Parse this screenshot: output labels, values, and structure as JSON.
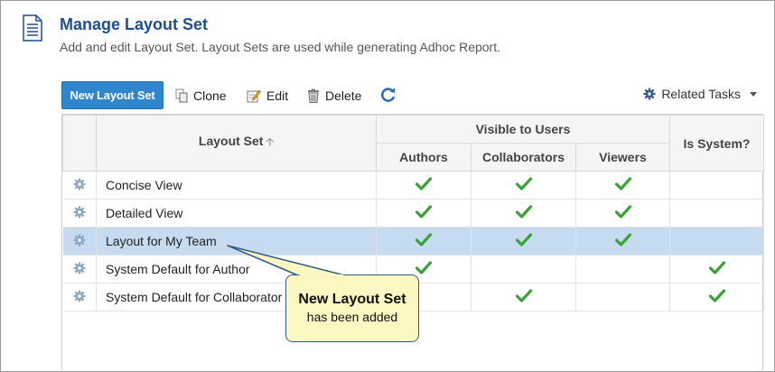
{
  "header": {
    "title": "Manage Layout Set",
    "subtitle": "Add and edit Layout Set. Layout Sets are used while generating Adhoc Report.",
    "icon": "document-icon"
  },
  "toolbar": {
    "new_label": "New Layout Set",
    "clone_label": "Clone",
    "edit_label": "Edit",
    "delete_label": "Delete",
    "related_label": "Related Tasks",
    "accent": "#2f86cd"
  },
  "grid": {
    "col_layout_set": "Layout Set",
    "group_visible": "Visible to Users",
    "col_authors": "Authors",
    "col_collaborators": "Collaborators",
    "col_viewers": "Viewers",
    "col_is_system": "Is System?",
    "rows": [
      {
        "name": "Concise View",
        "authors": true,
        "collaborators": true,
        "viewers": true,
        "system": false,
        "selected": false
      },
      {
        "name": "Detailed View",
        "authors": true,
        "collaborators": true,
        "viewers": true,
        "system": false,
        "selected": false
      },
      {
        "name": "Layout for My Team",
        "authors": true,
        "collaborators": true,
        "viewers": true,
        "system": false,
        "selected": true
      },
      {
        "name": "System Default for Author",
        "authors": true,
        "collaborators": false,
        "viewers": false,
        "system": true,
        "selected": false
      },
      {
        "name": "System Default for Collaborator",
        "authors": false,
        "collaborators": true,
        "viewers": false,
        "system": true,
        "selected": false
      }
    ]
  },
  "callout": {
    "title": "New Layout Set",
    "text": "has been added"
  },
  "colors": {
    "selected_row": "#c6dbf0",
    "check": "#3aa335",
    "callout_bg": "#fdf8c2"
  }
}
